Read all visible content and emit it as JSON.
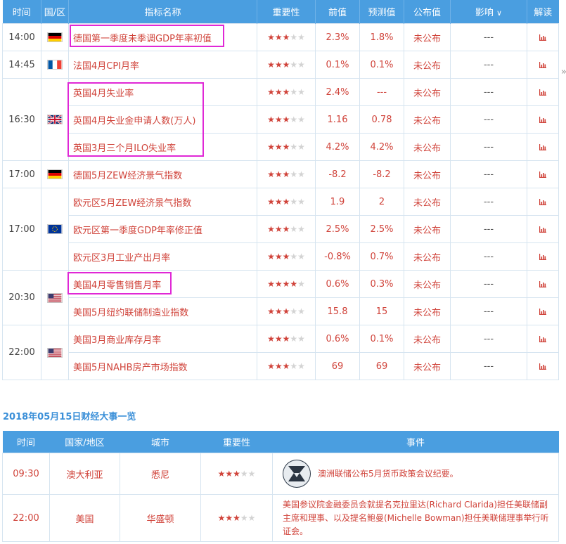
{
  "table1": {
    "headers": [
      "时间",
      "国/区",
      "指标名称",
      "重要性",
      "前值",
      "预测值",
      "公布值",
      "影响",
      "解读"
    ],
    "groups": [
      {
        "time": "14:00",
        "flag": "de",
        "rows": [
          {
            "name": "德国第一季度未季调GDP年率初值",
            "stars": 3,
            "prev": "2.3%",
            "forecast": "1.8%",
            "actual": "未公布",
            "impact": "---"
          }
        ]
      },
      {
        "time": "14:45",
        "flag": "fr",
        "rows": [
          {
            "name": "法国4月CPI月率",
            "stars": 3,
            "prev": "0.1%",
            "forecast": "0.1%",
            "actual": "未公布",
            "impact": "---"
          }
        ]
      },
      {
        "time": "16:30",
        "flag": "uk",
        "rows": [
          {
            "name": "英国4月失业率",
            "stars": 3,
            "prev": "2.4%",
            "forecast": "---",
            "actual": "未公布",
            "impact": "---"
          },
          {
            "name": "英国4月失业金申请人数(万人)",
            "stars": 3,
            "prev": "1.16",
            "forecast": "0.78",
            "actual": "未公布",
            "impact": "---"
          },
          {
            "name": "英国3月三个月ILO失业率",
            "stars": 3,
            "prev": "4.2%",
            "forecast": "4.2%",
            "actual": "未公布",
            "impact": "---"
          }
        ]
      },
      {
        "time": "17:00",
        "flag": "de",
        "rows": [
          {
            "name": "德国5月ZEW经济景气指数",
            "stars": 3,
            "prev": "-8.2",
            "forecast": "-8.2",
            "actual": "未公布",
            "impact": "---"
          }
        ]
      },
      {
        "time": "17:00",
        "flag": "eu",
        "rows": [
          {
            "name": "欧元区5月ZEW经济景气指数",
            "stars": 3,
            "prev": "1.9",
            "forecast": "2",
            "actual": "未公布",
            "impact": "---"
          },
          {
            "name": "欧元区第一季度GDP年率修正值",
            "stars": 3,
            "prev": "2.5%",
            "forecast": "2.5%",
            "actual": "未公布",
            "impact": "---"
          },
          {
            "name": "欧元区3月工业产出月率",
            "stars": 3,
            "prev": "-0.8%",
            "forecast": "0.7%",
            "actual": "未公布",
            "impact": "---"
          }
        ]
      },
      {
        "time": "20:30",
        "flag": "us",
        "rows": [
          {
            "name": "美国4月零售销售月率",
            "stars": 4,
            "prev": "0.6%",
            "forecast": "0.3%",
            "actual": "未公布",
            "impact": "---"
          },
          {
            "name": "美国5月纽约联储制造业指数",
            "stars": 3,
            "prev": "15.8",
            "forecast": "15",
            "actual": "未公布",
            "impact": "---"
          }
        ]
      },
      {
        "time": "22:00",
        "flag": "us",
        "rows": [
          {
            "name": "美国3月商业库存月率",
            "stars": 3,
            "prev": "0.6%",
            "forecast": "0.1%",
            "actual": "未公布",
            "impact": "---"
          },
          {
            "name": "美国5月NAHB房产市场指数",
            "stars": 3,
            "prev": "69",
            "forecast": "69",
            "actual": "未公布",
            "impact": "---"
          }
        ]
      }
    ]
  },
  "side_arrow": "»",
  "section2_title": "2018年05月15日财经大事一览",
  "table2": {
    "headers": [
      "时间",
      "国家/地区",
      "城市",
      "重要性",
      "事件"
    ],
    "rows": [
      {
        "time": "09:30",
        "country": "澳大利亚",
        "city": "悉尼",
        "stars": 3,
        "event": "澳洲联储公布5月货币政策会议纪要。",
        "logo": true
      },
      {
        "time": "22:00",
        "country": "美国",
        "city": "华盛顿",
        "stars": 3,
        "event": "美国参议院金融委员会就提名克拉里达(Richard Clarida)担任美联储副主席和理事、以及提名鲍曼(Michelle Bowman)担任美联储理事举行听证会。",
        "logo": false
      }
    ]
  },
  "colors": {
    "header_bg": "#4a9ee0",
    "text_red": "#d0433a",
    "highlight": "#e028d6",
    "title_blue": "#3a8fd8"
  }
}
